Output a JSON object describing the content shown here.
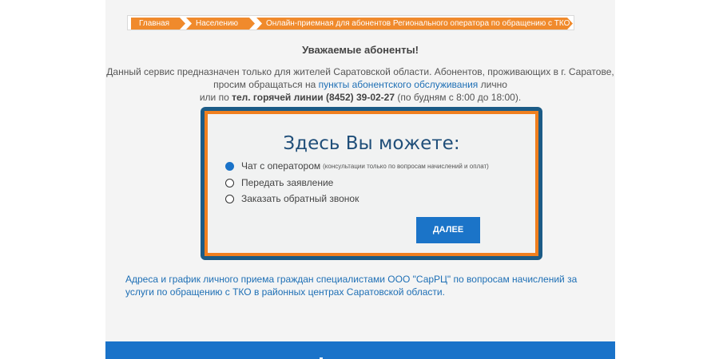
{
  "breadcrumb": [
    "Главная",
    "Населению",
    "Онлайн-приемная для абонентов Регионального оператора по обращению с ТКО"
  ],
  "greeting": "Уважаемые абоненты!",
  "intro": {
    "line1": "Данный сервис предназначен только для жителей Саратовской области. Абонентов, проживающих в г. Саратове,",
    "line2_before": "просим обращаться на ",
    "line2_link": "пункты абонентского обслуживания",
    "line2_after": " лично",
    "line3_before": "или по ",
    "line3_bold": "тел. горячей линии (8452) 39-02-27",
    "line3_after": " (по будням с 8:00 до 18:00)."
  },
  "dialog": {
    "title": "Здесь Вы можете:",
    "options": [
      {
        "label": "Чат с оператором",
        "note": "(консультации только по вопросам начислений и оплат)",
        "checked": true
      },
      {
        "label": "Передать заявление",
        "note": "",
        "checked": false
      },
      {
        "label": "Заказать обратный звонок",
        "note": "",
        "checked": false
      }
    ],
    "next_label": "ДАЛЕЕ"
  },
  "bottom_link": "Адреса и график личного приема граждан специалистами ООО \"СарРЦ\" по вопросам начислений за услуги по обращению с ТКО в районных центрах Саратовской области.",
  "colors": {
    "accent": "#f08a2c",
    "primary_blue": "#1b74c8",
    "link_blue": "#1e6fb5",
    "dialog_border": "#1c5b86"
  }
}
